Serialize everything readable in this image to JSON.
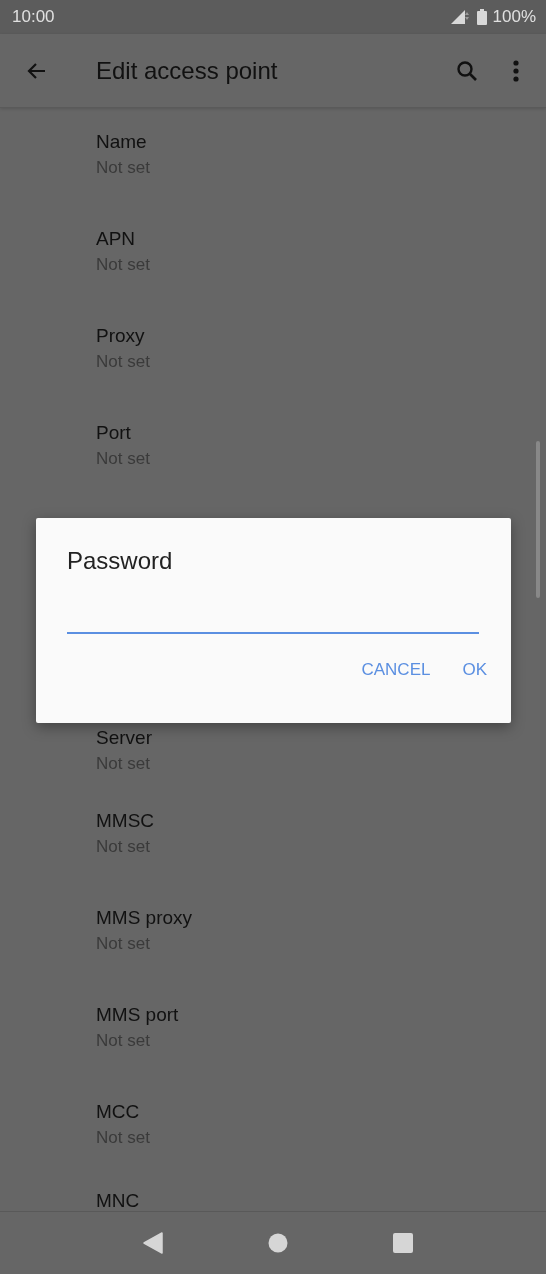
{
  "status_bar": {
    "time": "10:00",
    "battery": "100%"
  },
  "app_bar": {
    "title": "Edit access point"
  },
  "settings": [
    {
      "title": "Name",
      "value": "Not set"
    },
    {
      "title": "APN",
      "value": "Not set"
    },
    {
      "title": "Proxy",
      "value": "Not set"
    },
    {
      "title": "Port",
      "value": "Not set"
    },
    {
      "title": "Server",
      "value": "Not set"
    },
    {
      "title": "MMSC",
      "value": "Not set"
    },
    {
      "title": "MMS proxy",
      "value": "Not set"
    },
    {
      "title": "MMS port",
      "value": "Not set"
    },
    {
      "title": "MCC",
      "value": "Not set"
    },
    {
      "title": "MNC"
    }
  ],
  "dialog": {
    "title": "Password",
    "buttons": [
      "CANCEL",
      "OK"
    ]
  }
}
